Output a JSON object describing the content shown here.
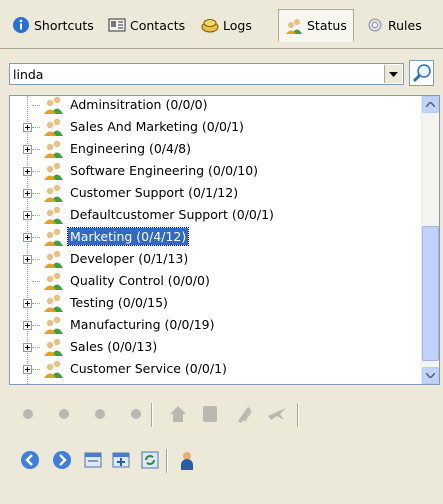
{
  "tabs": [
    {
      "label": "Shortcuts",
      "icon": "info-icon",
      "active": false
    },
    {
      "label": "Contacts",
      "icon": "contacts-icon",
      "active": false
    },
    {
      "label": "Logs",
      "icon": "logs-icon",
      "active": false
    },
    {
      "label": "Status",
      "icon": "status-icon",
      "active": true
    },
    {
      "label": "Rules",
      "icon": "rules-icon",
      "active": false
    }
  ],
  "search": {
    "value": "linda"
  },
  "tree": {
    "items": [
      {
        "label": "Adminsitration  (0/0/0)",
        "expandable": false,
        "selected": false
      },
      {
        "label": "Sales And Marketing  (0/0/1)",
        "expandable": true,
        "selected": false
      },
      {
        "label": "Engineering  (0/4/8)",
        "expandable": true,
        "selected": false
      },
      {
        "label": "Software Engineering  (0/0/10)",
        "expandable": true,
        "selected": false
      },
      {
        "label": "Customer Support  (0/1/12)",
        "expandable": true,
        "selected": false
      },
      {
        "label": "Defaultcustomer Support  (0/0/1)",
        "expandable": true,
        "selected": false
      },
      {
        "label": "Marketing  (0/4/12)",
        "expandable": true,
        "selected": true
      },
      {
        "label": "Developer  (0/1/13)",
        "expandable": true,
        "selected": false
      },
      {
        "label": "Quality Control  (0/0/0)",
        "expandable": false,
        "selected": false
      },
      {
        "label": "Testing  (0/0/15)",
        "expandable": true,
        "selected": false
      },
      {
        "label": "Manufacturing  (0/0/19)",
        "expandable": true,
        "selected": false
      },
      {
        "label": "Sales  (0/0/13)",
        "expandable": true,
        "selected": false
      },
      {
        "label": "Customer Service  (0/0/1)",
        "expandable": true,
        "selected": false
      }
    ]
  },
  "colors": {
    "selection": "#316ac5",
    "panel": "#ece9d8",
    "border": "#7f9db9",
    "disabled": "#b8b8b0"
  }
}
